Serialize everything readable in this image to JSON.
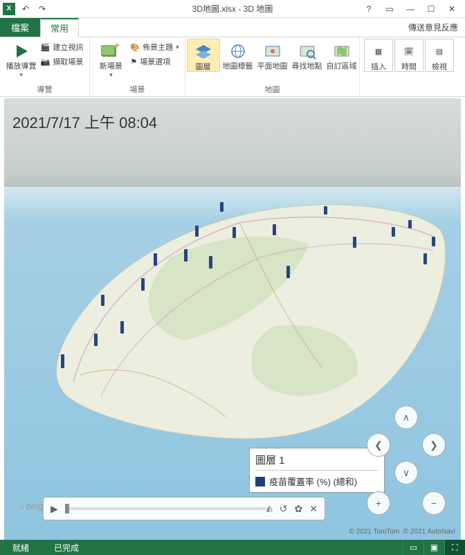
{
  "titlebar": {
    "title": "3D地圖.xlsx - 3D 地圖"
  },
  "tabs": {
    "file": "檔案",
    "home": "常用",
    "feedback": "傳送意見反應"
  },
  "ribbon": {
    "nav_group": "導覽",
    "scene_group": "場景",
    "map_group": "地圖",
    "play_tour": "播放導覽",
    "create_video": "建立視訊",
    "capture_scene": "擷取場景",
    "new_scene": "新場景",
    "scene_theme": "佈景主題",
    "scene_options": "場景選項",
    "layer": "圖層",
    "map_labels": "地圖標籤",
    "flat_map": "平面地圖",
    "find_location": "尋找地點",
    "custom_region": "自訂區域",
    "insert": "插入",
    "time": "時間",
    "view": "檢視"
  },
  "map": {
    "timestamp": "2021/7/17 上午 08:04",
    "legend_title": "圖層 1",
    "legend_series": "疫苗覆蓋率 (%) (總和)",
    "bing": "bing",
    "attribution1": "© 2021 TomTom",
    "attribution2": "© 2021 AutoNavi"
  },
  "status": {
    "ready": "就緒",
    "done": "已完成"
  }
}
